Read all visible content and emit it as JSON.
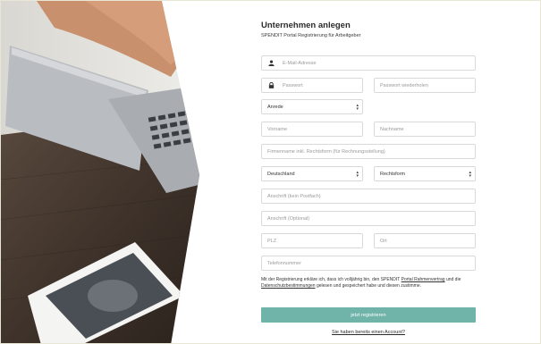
{
  "header": {
    "title": "Unternehmen anlegen",
    "subtitle": "SPENDIT Portal Registrierung für Arbeitgeber"
  },
  "form": {
    "email_placeholder": "E-Mail-Adresse",
    "password_placeholder": "Passwort",
    "password_repeat_placeholder": "Passwort wiederholen",
    "salutation_value": "Anrede",
    "firstname_placeholder": "Vorname",
    "lastname_placeholder": "Nachname",
    "company_placeholder": "Firmenname inkl. Rechtsform (für Rechnungsstellung)",
    "country_value": "Deutschland",
    "legal_form_value": "Rechtsform",
    "address_placeholder": "Anschrift (kein Postfach)",
    "address2_placeholder": "Anschrift (Optional)",
    "zip_placeholder": "PLZ",
    "city_placeholder": "Ort",
    "phone_placeholder": "Telefonnummer"
  },
  "terms": {
    "text_1": "Mit der Registrierung erkläre ich, dass ich volljährig bin, den SPENDIT ",
    "link_1": "Portal Rahmenvertrag",
    "text_2": " und die ",
    "link_2": "Datenschutzbestimmungen",
    "text_3": " gelesen und gespeichert habe und diesen zustimme."
  },
  "actions": {
    "submit_label": "jetzt registrieren",
    "account_link": "Sie haben bereits einen Account?"
  },
  "colors": {
    "accent": "#6fb3a9",
    "border": "#d9d9d9"
  },
  "icons": {
    "email": "user-icon",
    "password": "lock-icon",
    "select": "chevron-updown-icon"
  }
}
